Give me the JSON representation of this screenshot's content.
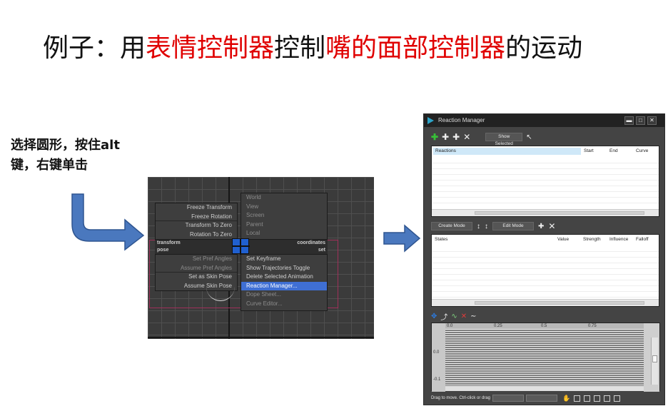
{
  "title": {
    "p1": "例子：用",
    "p2": "表情控制器",
    "p3": "控制",
    "p4": "嘴的面部控制器",
    "p5": "的运动"
  },
  "instruction": {
    "line1": "选择圆形，按住alt",
    "line2": "键，右键单击"
  },
  "quad_menu": {
    "top_left": [
      "Freeze Transform",
      "Freeze Rotation",
      "Transform To Zero",
      "Rotation To Zero"
    ],
    "top_right": [
      "World",
      "View",
      "Screen",
      "Parent",
      "Local"
    ],
    "bar_transform": "transform",
    "bar_coordinates": "coordinates",
    "bar_pose": "pose",
    "bar_set": "set",
    "bottom_left": [
      "Set Pref Angles",
      "Assume Pref Angles",
      "Set as Skin Pose",
      "Assume Skin Pose"
    ],
    "bottom_right": [
      "Set Keyframe",
      "Show Trajectories Toggle",
      "Delete Selected Animation",
      "Reaction Manager...",
      "Dope Sheet...",
      "Curve Editor..."
    ]
  },
  "reaction_manager": {
    "title": "Reaction Manager",
    "window_buttons": [
      "▬",
      "□",
      "✕"
    ],
    "show_selected": "Show Selected",
    "reactions_cols": [
      "Reactions",
      "Start",
      "End",
      "Curve"
    ],
    "create_mode": "Create Mode",
    "edit_mode": "Edit Mode",
    "states_cols": [
      "States",
      "Value",
      "Strength",
      "Influence",
      "Falloff"
    ],
    "graph_x_labels": [
      "0.0",
      "0.25",
      "0.5",
      "0.75"
    ],
    "graph_y_labels": [
      "0.0",
      "-0.1"
    ],
    "status_text": "Drag to move. Ctrl-click or drag"
  },
  "colors": {
    "accent_red": "#e00000",
    "arrow_blue": "#4a78be",
    "menu_highlight": "#3f6fd4"
  }
}
